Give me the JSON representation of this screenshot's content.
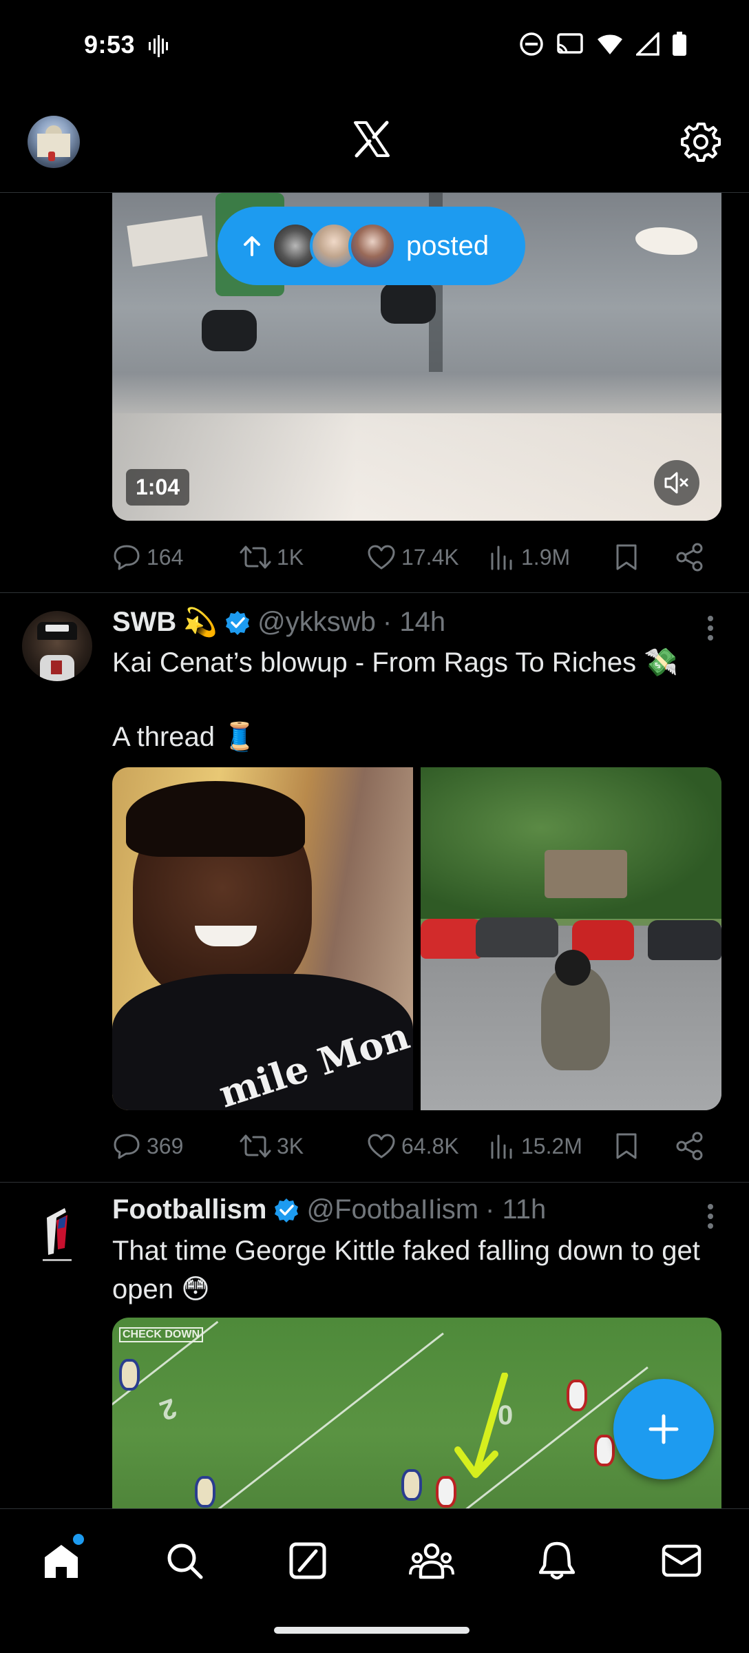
{
  "status_bar": {
    "time": "9:53"
  },
  "posted_pill": {
    "label": "posted"
  },
  "post1": {
    "duration": "1:04",
    "stats": {
      "replies": "164",
      "reposts": "1K",
      "likes": "17.4K",
      "views": "1.9M"
    }
  },
  "post2": {
    "name": "SWB",
    "name_emoji": "💫",
    "handle": "@ykkswb",
    "time": "· 14h",
    "text_line1": "Kai Cenat’s blowup - From Rags To Riches 💸",
    "text_line2": "A thread 🧵",
    "image_text": "mile Mon",
    "stats": {
      "replies": "369",
      "reposts": "3K",
      "likes": "64.8K",
      "views": "15.2M"
    }
  },
  "post3": {
    "name": "Footballism",
    "handle": "@FootbaIIism",
    "time": "· 11h",
    "text": "That time George Kittle faked falling down to get open 😳",
    "media_badge": "CHECK DOWN"
  },
  "icons": {
    "top": [
      "profile-avatar",
      "x-logo-icon",
      "gear-icon"
    ],
    "bottom_nav": [
      "home-icon",
      "search-icon",
      "grok-icon",
      "communities-icon",
      "bell-icon",
      "mail-icon"
    ]
  },
  "colors": {
    "accent": "#1d9bf0",
    "background": "#000000",
    "muted": "#71767b",
    "text": "#e7e9ea"
  }
}
